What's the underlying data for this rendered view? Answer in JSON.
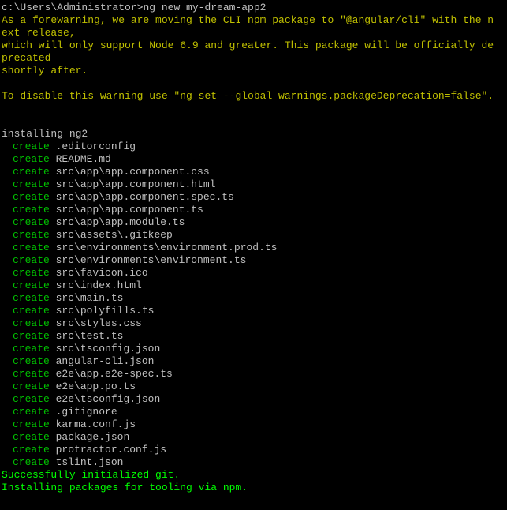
{
  "prompt": {
    "cwd": "c:\\Users\\Administrator>",
    "command": "ng new my-dream-app2"
  },
  "warning": {
    "line1": "As a forewarning, we are moving the CLI npm package to \"@angular/cli\" with the n",
    "line2": "ext release,",
    "line3": "which will only support Node 6.9 and greater. This package will be officially de",
    "line4": "precated",
    "line5": "shortly after.",
    "line6": "To disable this warning use \"ng set --global warnings.packageDeprecation=false\"."
  },
  "installing": "installing ng2",
  "action_label": "create",
  "files": [
    ".editorconfig",
    "README.md",
    "src\\app\\app.component.css",
    "src\\app\\app.component.html",
    "src\\app\\app.component.spec.ts",
    "src\\app\\app.component.ts",
    "src\\app\\app.module.ts",
    "src\\assets\\.gitkeep",
    "src\\environments\\environment.prod.ts",
    "src\\environments\\environment.ts",
    "src\\favicon.ico",
    "src\\index.html",
    "src\\main.ts",
    "src\\polyfills.ts",
    "src\\styles.css",
    "src\\test.ts",
    "src\\tsconfig.json",
    "angular-cli.json",
    "e2e\\app.e2e-spec.ts",
    "e2e\\app.po.ts",
    "e2e\\tsconfig.json",
    ".gitignore",
    "karma.conf.js",
    "package.json",
    "protractor.conf.js",
    "tslint.json"
  ],
  "status": {
    "git": "Successfully initialized git.",
    "npm": "Installing packages for tooling via npm."
  }
}
